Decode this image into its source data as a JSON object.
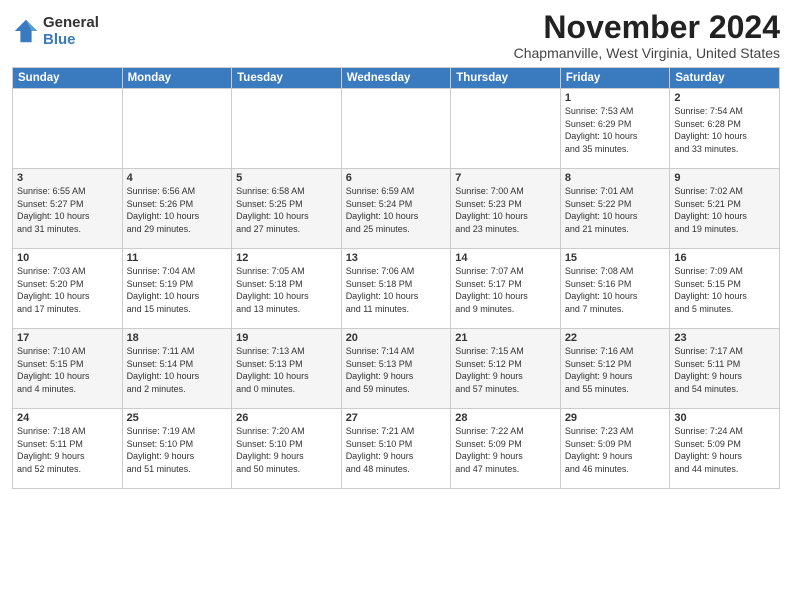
{
  "logo": {
    "line1": "General",
    "line2": "Blue"
  },
  "title": "November 2024",
  "subtitle": "Chapmanville, West Virginia, United States",
  "weekdays": [
    "Sunday",
    "Monday",
    "Tuesday",
    "Wednesday",
    "Thursday",
    "Friday",
    "Saturday"
  ],
  "weeks": [
    [
      {
        "day": "",
        "info": ""
      },
      {
        "day": "",
        "info": ""
      },
      {
        "day": "",
        "info": ""
      },
      {
        "day": "",
        "info": ""
      },
      {
        "day": "",
        "info": ""
      },
      {
        "day": "1",
        "info": "Sunrise: 7:53 AM\nSunset: 6:29 PM\nDaylight: 10 hours\nand 35 minutes."
      },
      {
        "day": "2",
        "info": "Sunrise: 7:54 AM\nSunset: 6:28 PM\nDaylight: 10 hours\nand 33 minutes."
      }
    ],
    [
      {
        "day": "3",
        "info": "Sunrise: 6:55 AM\nSunset: 5:27 PM\nDaylight: 10 hours\nand 31 minutes."
      },
      {
        "day": "4",
        "info": "Sunrise: 6:56 AM\nSunset: 5:26 PM\nDaylight: 10 hours\nand 29 minutes."
      },
      {
        "day": "5",
        "info": "Sunrise: 6:58 AM\nSunset: 5:25 PM\nDaylight: 10 hours\nand 27 minutes."
      },
      {
        "day": "6",
        "info": "Sunrise: 6:59 AM\nSunset: 5:24 PM\nDaylight: 10 hours\nand 25 minutes."
      },
      {
        "day": "7",
        "info": "Sunrise: 7:00 AM\nSunset: 5:23 PM\nDaylight: 10 hours\nand 23 minutes."
      },
      {
        "day": "8",
        "info": "Sunrise: 7:01 AM\nSunset: 5:22 PM\nDaylight: 10 hours\nand 21 minutes."
      },
      {
        "day": "9",
        "info": "Sunrise: 7:02 AM\nSunset: 5:21 PM\nDaylight: 10 hours\nand 19 minutes."
      }
    ],
    [
      {
        "day": "10",
        "info": "Sunrise: 7:03 AM\nSunset: 5:20 PM\nDaylight: 10 hours\nand 17 minutes."
      },
      {
        "day": "11",
        "info": "Sunrise: 7:04 AM\nSunset: 5:19 PM\nDaylight: 10 hours\nand 15 minutes."
      },
      {
        "day": "12",
        "info": "Sunrise: 7:05 AM\nSunset: 5:18 PM\nDaylight: 10 hours\nand 13 minutes."
      },
      {
        "day": "13",
        "info": "Sunrise: 7:06 AM\nSunset: 5:18 PM\nDaylight: 10 hours\nand 11 minutes."
      },
      {
        "day": "14",
        "info": "Sunrise: 7:07 AM\nSunset: 5:17 PM\nDaylight: 10 hours\nand 9 minutes."
      },
      {
        "day": "15",
        "info": "Sunrise: 7:08 AM\nSunset: 5:16 PM\nDaylight: 10 hours\nand 7 minutes."
      },
      {
        "day": "16",
        "info": "Sunrise: 7:09 AM\nSunset: 5:15 PM\nDaylight: 10 hours\nand 5 minutes."
      }
    ],
    [
      {
        "day": "17",
        "info": "Sunrise: 7:10 AM\nSunset: 5:15 PM\nDaylight: 10 hours\nand 4 minutes."
      },
      {
        "day": "18",
        "info": "Sunrise: 7:11 AM\nSunset: 5:14 PM\nDaylight: 10 hours\nand 2 minutes."
      },
      {
        "day": "19",
        "info": "Sunrise: 7:13 AM\nSunset: 5:13 PM\nDaylight: 10 hours\nand 0 minutes."
      },
      {
        "day": "20",
        "info": "Sunrise: 7:14 AM\nSunset: 5:13 PM\nDaylight: 9 hours\nand 59 minutes."
      },
      {
        "day": "21",
        "info": "Sunrise: 7:15 AM\nSunset: 5:12 PM\nDaylight: 9 hours\nand 57 minutes."
      },
      {
        "day": "22",
        "info": "Sunrise: 7:16 AM\nSunset: 5:12 PM\nDaylight: 9 hours\nand 55 minutes."
      },
      {
        "day": "23",
        "info": "Sunrise: 7:17 AM\nSunset: 5:11 PM\nDaylight: 9 hours\nand 54 minutes."
      }
    ],
    [
      {
        "day": "24",
        "info": "Sunrise: 7:18 AM\nSunset: 5:11 PM\nDaylight: 9 hours\nand 52 minutes."
      },
      {
        "day": "25",
        "info": "Sunrise: 7:19 AM\nSunset: 5:10 PM\nDaylight: 9 hours\nand 51 minutes."
      },
      {
        "day": "26",
        "info": "Sunrise: 7:20 AM\nSunset: 5:10 PM\nDaylight: 9 hours\nand 50 minutes."
      },
      {
        "day": "27",
        "info": "Sunrise: 7:21 AM\nSunset: 5:10 PM\nDaylight: 9 hours\nand 48 minutes."
      },
      {
        "day": "28",
        "info": "Sunrise: 7:22 AM\nSunset: 5:09 PM\nDaylight: 9 hours\nand 47 minutes."
      },
      {
        "day": "29",
        "info": "Sunrise: 7:23 AM\nSunset: 5:09 PM\nDaylight: 9 hours\nand 46 minutes."
      },
      {
        "day": "30",
        "info": "Sunrise: 7:24 AM\nSunset: 5:09 PM\nDaylight: 9 hours\nand 44 minutes."
      }
    ]
  ]
}
